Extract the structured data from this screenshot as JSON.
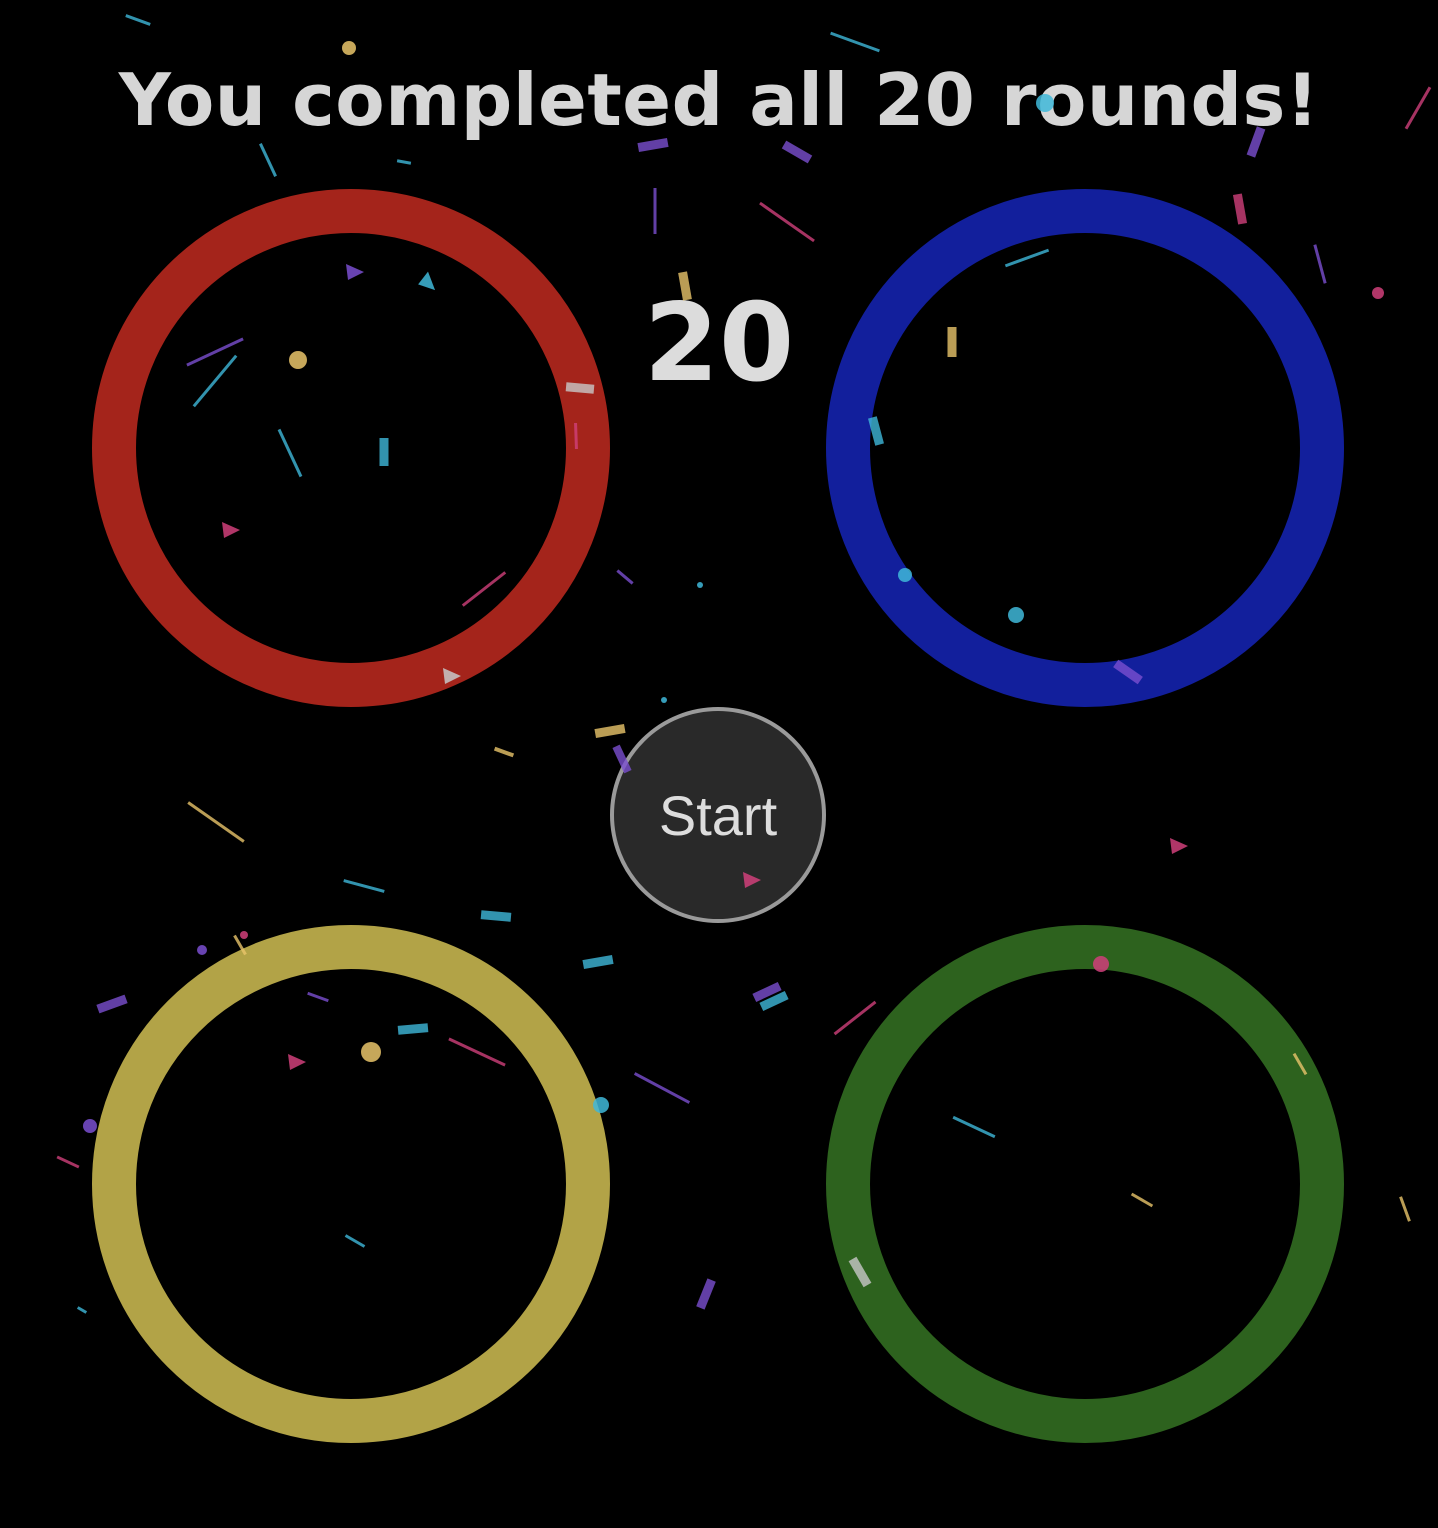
{
  "game": {
    "message": "You completed all 20 rounds!",
    "round_count": "20",
    "start_label": "Start"
  },
  "pads": [
    {
      "name": "red-pad",
      "color": "#a4241b"
    },
    {
      "name": "blue-pad",
      "color": "#121f9c"
    },
    {
      "name": "yellow-pad",
      "color": "#b2a347"
    },
    {
      "name": "green-pad",
      "color": "#2d621e"
    }
  ],
  "confetti_colors": [
    "#e9c46a",
    "#3fb8d9",
    "#d0407a",
    "#7a4fd0",
    "#c8c8c8"
  ]
}
